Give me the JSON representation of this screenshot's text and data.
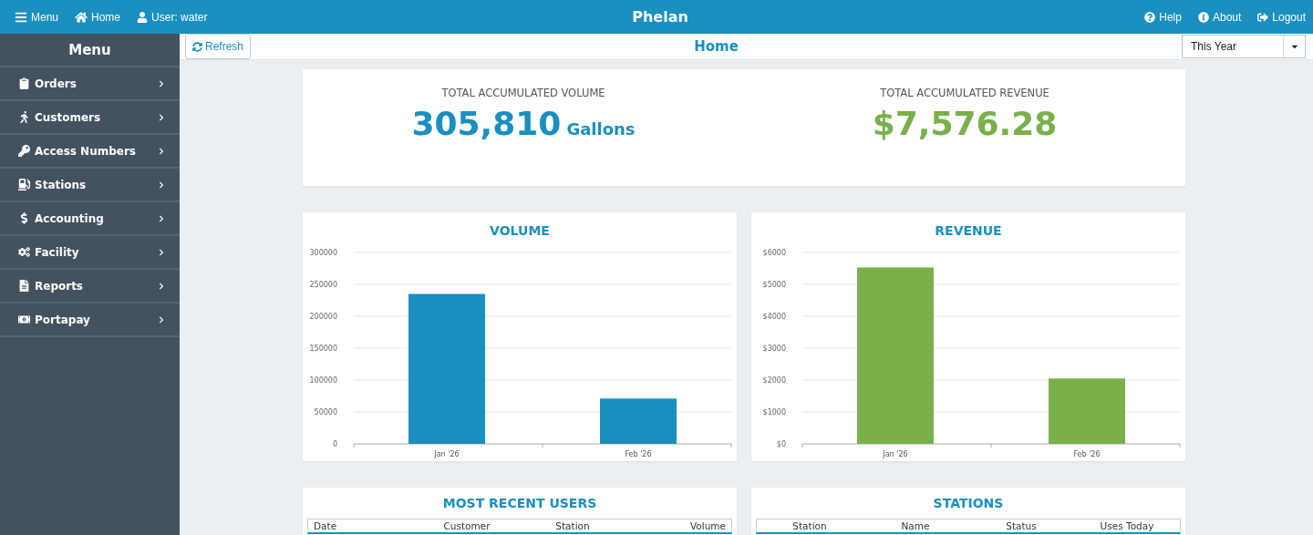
{
  "topbar": {
    "left": [
      "Menu",
      "Home",
      "User: water"
    ],
    "title": "Phelan",
    "right": [
      "Help",
      "About",
      "Logout"
    ]
  },
  "sidebar": {
    "title": "Menu",
    "items": [
      {
        "label": "Orders"
      },
      {
        "label": "Customers"
      },
      {
        "label": "Access Numbers"
      },
      {
        "label": "Stations"
      },
      {
        "label": "Accounting"
      },
      {
        "label": "Facility"
      },
      {
        "label": "Reports"
      },
      {
        "label": "Portapay"
      }
    ]
  },
  "toolbar": {
    "refresh": "Refresh",
    "title": "Home",
    "period": "This Year"
  },
  "totals": [
    {
      "label": "TOTAL ACCUMULATED VOLUME",
      "value": "305,810",
      "unit": "Gallons",
      "color": "#1a8fc0"
    },
    {
      "label": "TOTAL ACCUMULATED REVENUE",
      "value": "$7,576.28",
      "color": "#79b04a"
    }
  ],
  "charts": [
    {
      "chart_data": {
        "type": "bar",
        "title": "VOLUME",
        "categories": [
          "Jan '26",
          "Feb '26"
        ],
        "series": [
          {
            "color": "#1a8fc0",
            "values": [
              235000,
              71000
            ]
          }
        ],
        "grid": true,
        "ylim": [
          0,
          300000
        ],
        "yticks": [
          0,
          50000,
          100000,
          150000,
          200000,
          250000,
          300000
        ]
      }
    },
    {
      "chart_data": {
        "type": "bar",
        "title": "REVENUE",
        "categories": [
          "Jan '26",
          "Feb '26"
        ],
        "series": [
          {
            "color": "#79b04a",
            "values": [
              5530,
              2050
            ]
          }
        ],
        "grid": true,
        "ylim": [
          0,
          6000
        ],
        "yticks": [
          {
            "value": 0,
            "label": "$0"
          },
          {
            "value": 1000,
            "label": "$1000"
          },
          {
            "value": 2000,
            "label": "$2000"
          },
          {
            "value": 3000,
            "label": "$3000"
          },
          {
            "value": 4000,
            "label": "$4000"
          },
          {
            "value": 5000,
            "label": "$5000"
          },
          {
            "value": 6000,
            "label": "$6000"
          }
        ]
      }
    }
  ],
  "tables": [
    {
      "title": "MOST RECENT USERS",
      "columns": [
        "Date",
        "Customer",
        "Station",
        "Volume"
      ]
    },
    {
      "title": "STATIONS",
      "columns": [
        "Station",
        "Name",
        "Status",
        "Uses Today"
      ]
    }
  ]
}
